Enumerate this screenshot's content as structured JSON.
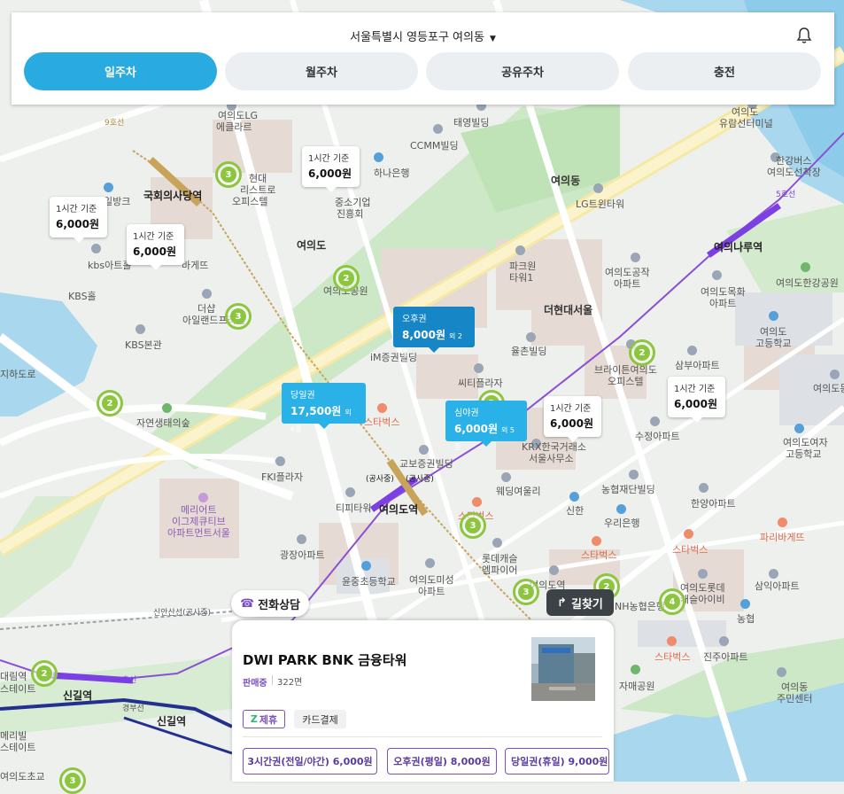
{
  "header": {
    "location": "서울특별시 영등포구 여의동",
    "bell_icon": "bell-icon",
    "tabs": [
      {
        "label": "일주차",
        "active": true
      },
      {
        "label": "월주차",
        "active": false
      },
      {
        "label": "공유주차",
        "active": false
      },
      {
        "label": "충전",
        "active": false
      }
    ]
  },
  "map": {
    "labels": {
      "yeouido_lg": "여의도LG",
      "ekolre": "에클라르",
      "taeyoung": "태영빌딩",
      "ccmm": "CCMM빌딩",
      "yeouido_bus": "여의도",
      "yuram": "유람선터미널",
      "hangang_bus": "한강버스",
      "yeouido_dock": "여의도선착장",
      "hyundai1": "현대",
      "hyundai2": "리스트로",
      "hyundai3": "오피스텔",
      "hana": "하나은행",
      "jungso1": "중소기업",
      "jungso2": "진흥회",
      "yeouidong": "여의동",
      "lgtwin": "LG트윈타워",
      "ilbang": "일방크",
      "gukhoe": "국회의사당역",
      "yeouido_island": "여의도",
      "yeouinaru": "여의나루역",
      "kbs_art": "kbs아트홀",
      "kbs_hall": "KBS홀",
      "bakery": "바게뜨",
      "parc1": "파크원",
      "parc2": "타워1",
      "yeouido_gongjak": "여의도공작",
      "apt": "아파트",
      "yeouido_mokhwa": "여의도목화",
      "apt2": "아파트",
      "hangang_park": "여의도한강공원",
      "the_hyundai": "더현대서울",
      "yeouido_park_lbl": "여의도공원",
      "dasap": "더샵",
      "island_prime": "아일랜드프라임",
      "kbs_main": "KBS본관",
      "im_bank": "iM증권빌딩",
      "yulchon": "율촌빌딩",
      "yeouido_hs1": "여의도",
      "yeouido_hs2": "고등학교",
      "brighton1": "브라이튼여의도",
      "brighton2": "오피스텔",
      "sambu": "삼부아파트",
      "yeouido_east": "여의도동",
      "hajido": "지하도로",
      "citiplaza": "씨티플라자",
      "ecopark": "자연생태의숲",
      "suzeong": "수정아파트",
      "starbucks1": "스타벅스",
      "krx1": "KRX한국거래소",
      "krx2": "서울사무소",
      "girls_hs1": "여의도여자",
      "girls_hs2": "고등학교",
      "kyobo": "교보증권빌딩",
      "fki": "FKI플라자",
      "gongsajung1": "(공사중)",
      "gongsajung2": "(공사중)",
      "wedding": "웨딩여울리",
      "nonghyup": "농협재단빌딩",
      "tipi": "티피타워",
      "yeouido_sta": "여의도역",
      "shinhan": "신한",
      "hanyang": "한양아파트",
      "meriot1": "메리어트",
      "meriot2": "이그제큐티브",
      "meriot3": "아파트먼트서울",
      "woori": "우리은행",
      "paris": "파리바게뜨",
      "starbucks2": "스타벅스",
      "lotte1": "롯데캐슬",
      "lotte2": "엠파이어",
      "gwangjang": "광장아파트",
      "starbucks3": "스타벅스",
      "starbucks4": "스타벅스",
      "yoonjung": "윤중초등학교",
      "mison1": "여의도미성",
      "mison2": "아파트",
      "yeouido_sta2": "여의도역",
      "samik": "삼익아파트",
      "nh": "NH농협은행",
      "lotte_castle1": "여의도롯데",
      "lotte_castle2": "캐슬아이비",
      "nh2": "농협",
      "shinan": "신안산선(공사중)",
      "starbucks5": "스타벅스",
      "jinju": "진주아파트",
      "jamae": "자매공원",
      "center1": "여의동",
      "center2": "주민센터",
      "singil": "신길역",
      "singil2": "신길역",
      "gyeongbu": "경부선",
      "mearial1": "메리빌",
      "mearial2": "스테이트",
      "line5": "5호선",
      "gukhoe_line": "9호선",
      "yeouido_police": "여의도초교",
      "daerim": "대림역",
      "line5b": "5호선",
      "nodeul": "스테이트"
    },
    "price_pins": [
      {
        "sub": "1시간 기준",
        "price": "6,000원"
      },
      {
        "sub": "1시간 기준",
        "price": "6,000원"
      },
      {
        "sub": "1시간 기준",
        "price": "6,000원"
      },
      {
        "sub": "1시간 기준",
        "price": "6,000원"
      },
      {
        "sub": "1시간 기준",
        "price": "6,000원"
      }
    ],
    "ticket_pins": [
      {
        "sub": "오후권",
        "price": "8,000원",
        "count": "외 2종",
        "color": "#1686c6"
      },
      {
        "sub": "당일권",
        "price": "17,500원",
        "count": "외 6종",
        "color": "#29b1e8"
      },
      {
        "sub": "심야권",
        "price": "6,000원",
        "count": "외 5종",
        "color": "#29b1e8"
      }
    ],
    "clusters": [
      3,
      2,
      3,
      2,
      2,
      2,
      3,
      3,
      2,
      4,
      3,
      2
    ],
    "cluster_color": "#8cc63f"
  },
  "actions": {
    "call_label": "전화상담",
    "route_label": "길찾기"
  },
  "detail": {
    "name": "DWI PARK BNK 금융타워",
    "status": "판매중",
    "spaces": "322면",
    "chips": [
      "제휴",
      "카드결제"
    ],
    "tickets": [
      "3시간권(전일/야간) 6,000원",
      "오후권(평일) 8,000원",
      "당일권(휴일) 9,000원"
    ],
    "accent": "#7a4fbf"
  }
}
